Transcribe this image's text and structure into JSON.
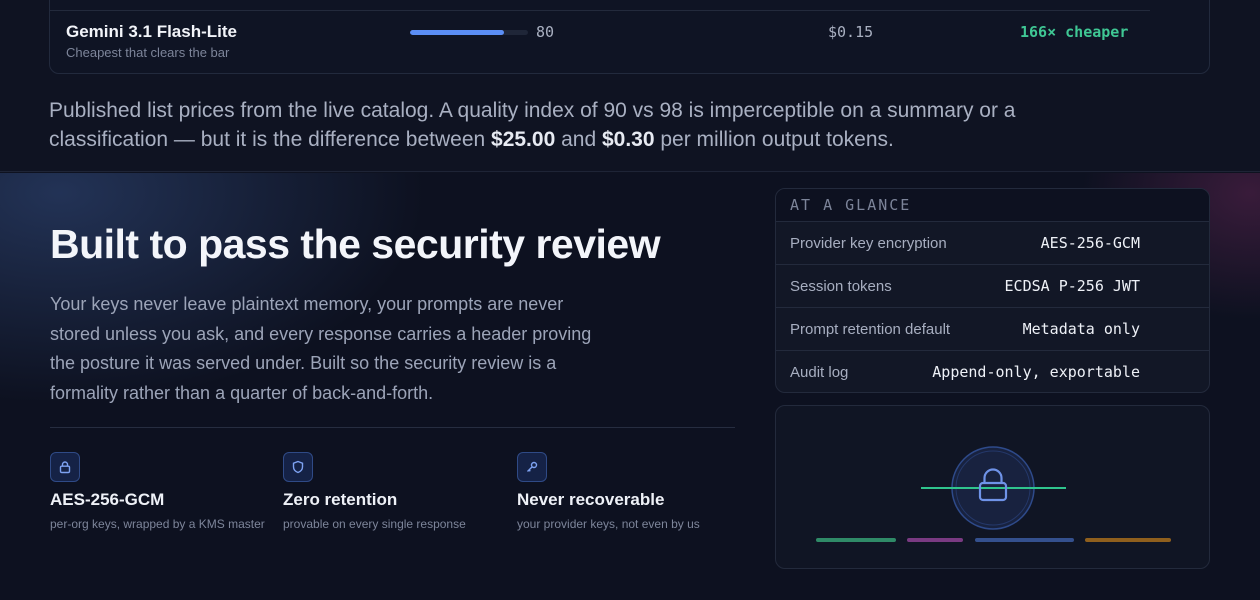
{
  "model_row": {
    "name": "Gemini 3.1 Flash-Lite",
    "subtitle": "Cheapest that clears the bar",
    "quality_index": "80",
    "quality_fraction": 0.8,
    "price": "$0.15",
    "savings": "166× cheaper"
  },
  "pricing_note": {
    "part1": "Published list prices from the live catalog. A quality index of 90 vs 98 is imperceptible on a summary or a classification — but it is the difference between ",
    "price_high": "$25.00",
    "part2": " and ",
    "price_low": "$0.30",
    "part3": " per million output tokens."
  },
  "security": {
    "title": "Built to pass the security review",
    "description": "Your keys never leave plaintext memory, your prompts are never stored unless you ask, and every response carries a header proving the posture it was served under. Built so the security review is a formality rather than a quarter of back-and-forth.",
    "features": [
      {
        "icon": "lock-icon",
        "title": "AES-256-GCM",
        "subtitle": "per-org keys, wrapped by a KMS master"
      },
      {
        "icon": "shield-icon",
        "title": "Zero retention",
        "subtitle": "provable on every single response"
      },
      {
        "icon": "key-icon",
        "title": "Never recoverable",
        "subtitle": "your provider keys, not even by us"
      }
    ]
  },
  "at_a_glance": {
    "heading": "AT A GLANCE",
    "rows": [
      {
        "label": "Provider key encryption",
        "value": "AES-256-GCM"
      },
      {
        "label": "Session tokens",
        "value": "ECDSA P-256 JWT"
      },
      {
        "label": "Prompt retention default",
        "value": "Metadata only"
      },
      {
        "label": "Audit log",
        "value": "Append-only, exportable"
      }
    ]
  },
  "colors": {
    "accent_blue": "#5b8ef5",
    "success_green": "#3fc794",
    "bar_green": "#2f8a67",
    "bar_purple": "#7a3a82",
    "bar_blue": "#34508e",
    "bar_amber": "#8f5f1d"
  }
}
